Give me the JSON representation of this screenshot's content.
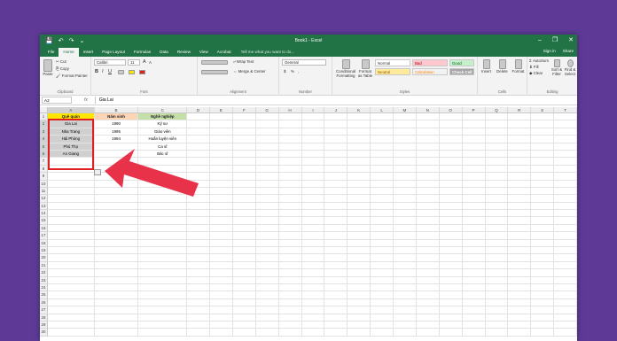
{
  "window": {
    "title": "Book1 - Excel",
    "minimize": "–",
    "restore": "❐",
    "close": "✕"
  },
  "qat": {
    "save": "💾",
    "undo": "↶",
    "redo": "↷",
    "customize": "⌄"
  },
  "tabs": [
    "File",
    "Home",
    "Insert",
    "Page Layout",
    "Formulas",
    "Data",
    "Review",
    "View",
    "Acrobat"
  ],
  "tell_me": "Tell me what you want to do...",
  "sign_in": "Sign in",
  "share": "Share",
  "clipboard": {
    "paste": "Paste",
    "cut": "Cut",
    "copy": "Copy",
    "format_painter": "Format Painter",
    "label": "Clipboard"
  },
  "font": {
    "name": "Calibri",
    "size": "11",
    "bold": "B",
    "italic": "I",
    "underline": "U",
    "grow": "A",
    "shrink": "A",
    "label": "Font"
  },
  "alignment": {
    "wrap": "Wrap Text",
    "merge": "Merge & Center",
    "label": "Alignment"
  },
  "number": {
    "format": "General",
    "currency": "$",
    "percent": "%",
    "comma": ",",
    "label": "Number"
  },
  "styles": {
    "conditional": "Conditional Formatting",
    "format_table": "Format as Table",
    "cells": [
      {
        "name": "Normal",
        "bg": "#ffffff",
        "fg": "#000000"
      },
      {
        "name": "Bad",
        "bg": "#ffc7ce",
        "fg": "#9c0006"
      },
      {
        "name": "Good",
        "bg": "#c6efce",
        "fg": "#006100"
      },
      {
        "name": "Neutral",
        "bg": "#ffeb9c",
        "fg": "#9c5700"
      },
      {
        "name": "Calculation",
        "bg": "#f2f2f2",
        "fg": "#fa7d00"
      },
      {
        "name": "Check Cell",
        "bg": "#a5a5a5",
        "fg": "#ffffff"
      }
    ],
    "label": "Styles"
  },
  "cells_group": {
    "insert": "Insert",
    "delete": "Delete",
    "format": "Format",
    "label": "Cells"
  },
  "editing": {
    "autosum": "AutoSum",
    "fill": "Fill",
    "clear": "Clear",
    "sort": "Sort & Filter",
    "find": "Find & Select",
    "label": "Editing"
  },
  "formula_bar": {
    "name_box": "A2",
    "fx": "fx",
    "value": "Gia Lai"
  },
  "columns": [
    "A",
    "B",
    "C",
    "D",
    "E",
    "F",
    "G",
    "H",
    "I",
    "J",
    "K",
    "L",
    "M",
    "N",
    "O",
    "P",
    "Q",
    "R",
    "S",
    "T"
  ],
  "rows": [
    "1",
    "2",
    "3",
    "4",
    "5",
    "6",
    "7",
    "8",
    "9",
    "10",
    "11",
    "12",
    "13",
    "14",
    "15",
    "16",
    "17",
    "18",
    "19",
    "20",
    "21",
    "22",
    "23",
    "24",
    "25",
    "26",
    "27",
    "28",
    "29",
    "30"
  ],
  "table": {
    "headers": [
      "Quê quán",
      "Năm sinh",
      "Nghề nghiệp"
    ],
    "data": [
      [
        "Gia Lai",
        "1990",
        "Kỹ sư"
      ],
      [
        "Nha Trang",
        "1995",
        "Giáo viên"
      ],
      [
        "Hải Phòng",
        "1994",
        "Huấn luyện viên"
      ],
      [
        "Phú Thọ",
        "",
        "Ca sĩ"
      ],
      [
        "An Giang",
        "",
        "Bác sĩ"
      ]
    ]
  },
  "colors": {
    "excel_green": "#217346",
    "background": "#5e3a96",
    "arrow": "#e8324a"
  }
}
